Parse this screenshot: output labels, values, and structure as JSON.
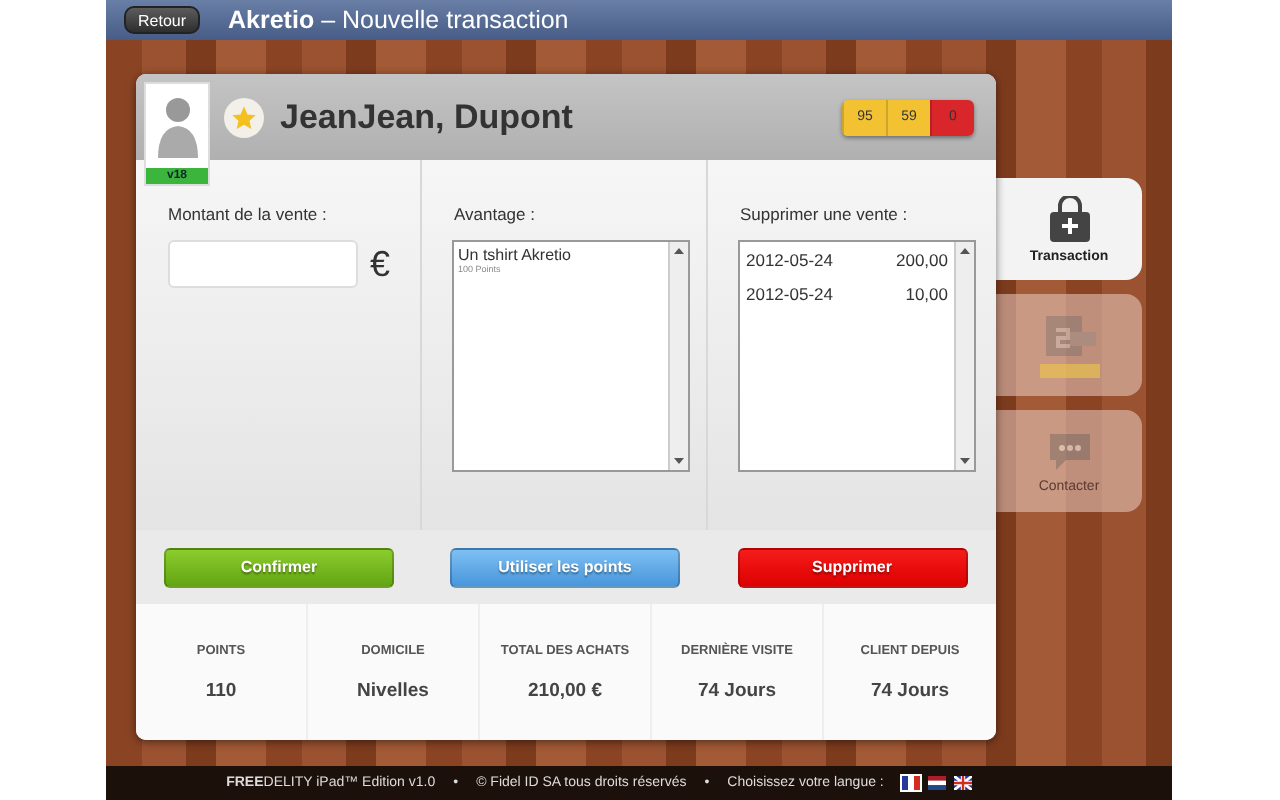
{
  "header": {
    "back_button": "Retour",
    "title": "**Akretio** – Nouvelle transaction"
  },
  "customer": {
    "name": "JeanJean, Dupont",
    "avatar_badge": "v18",
    "favorite": true,
    "scores": [
      {
        "value": "95",
        "color": "#f2c233"
      },
      {
        "value": "59",
        "color": "#f2c233"
      },
      {
        "value": "0",
        "color": "#d9262b"
      }
    ]
  },
  "sale_amount": {
    "label": "Montant de la vente :",
    "currency": "€"
  },
  "advantage": {
    "label": "Avantage :",
    "items": [
      {
        "title": "Un tshirt Akretio",
        "detail": "100 Points",
        "selected": false
      }
    ]
  },
  "delete_sale": {
    "label": "Supprimer une vente :",
    "rows": [
      {
        "date": "2012-05-24",
        "amount": "200,00",
        "selected": false
      },
      {
        "date": "2012-05-24",
        "amount": "10,00",
        "selected": false
      }
    ]
  },
  "buttons": [
    {
      "label": "Confirmer",
      "kind": "confirm"
    },
    {
      "label": "Utiliser les points",
      "kind": "points"
    },
    {
      "label": "Supprimer",
      "kind": "delete"
    }
  ],
  "stats": [
    {
      "label": "POINTS",
      "value": "110"
    },
    {
      "label": "DOMICILE",
      "value": "Nivelles"
    },
    {
      "label": "TOTAL DES ACHATS",
      "value": "210,00 €"
    },
    {
      "label": "DERNIÈRE VISITE",
      "value": "74 Jours"
    },
    {
      "label": "CLIENT DEPUIS",
      "value": "74 Jours"
    }
  ],
  "side_tabs": [
    {
      "kind": "bag",
      "label": "Transaction",
      "selected": true,
      "disabled": false
    },
    {
      "kind": "coupon",
      "selected": false,
      "disabled": true
    },
    {
      "kind": "chat",
      "label": "Contacter",
      "selected": false,
      "disabled": true
    }
  ],
  "footer": {
    "product": "**FREE**DELITY iPad™ Edition v1.0",
    "separator_1": "•",
    "copyright": "© Fidel ID SA tous droits réservés",
    "separator_2": "•",
    "language_label": "Choisissez votre langue :",
    "languages": [
      {
        "kind": "fr",
        "selected": true
      },
      {
        "kind": "nl",
        "selected": false
      },
      {
        "kind": "en",
        "selected": false
      }
    ]
  }
}
